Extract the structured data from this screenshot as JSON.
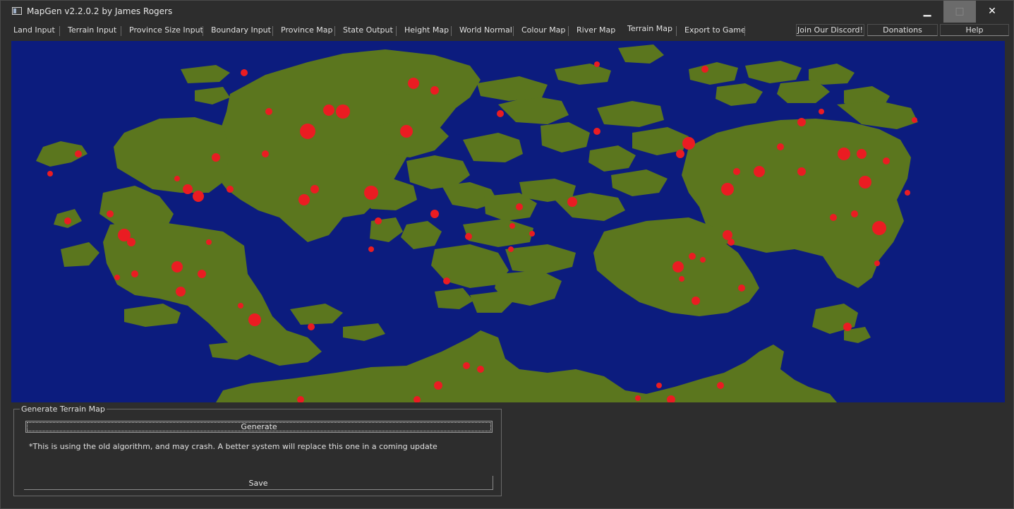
{
  "window": {
    "title": "MapGen v2.2.0.2 by James Rogers"
  },
  "window_controls": {
    "minimize": "▁",
    "maximize": "□",
    "close": "✕"
  },
  "tabs": [
    "Land Input",
    "Terrain Input",
    "Province Size Input",
    "Boundary Input",
    "Province Map",
    "State Output",
    "Height Map",
    "World Normal",
    "Colour Map",
    "River Map",
    "Terrain Map",
    "Export to Game"
  ],
  "active_tab": "Terrain Map",
  "top_buttons": {
    "discord": "Join Our Discord!",
    "donations": "Donations",
    "help": "Help"
  },
  "map": {
    "ocean_color": "#0c1c7e",
    "land_color": "#5b761e",
    "feature_color": "#ea1c22"
  },
  "panel": {
    "title": "Generate Terrain Map",
    "generate": "Generate",
    "note": "*This is using the old algorithm, and may crash. A better system will replace this one in a coming update",
    "save": "Save"
  }
}
